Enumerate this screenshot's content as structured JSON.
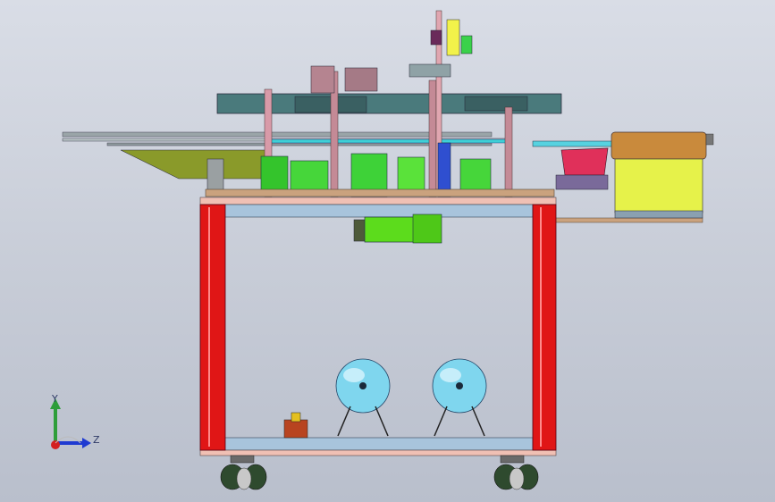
{
  "window": {
    "title": ""
  },
  "triad": {
    "y_label": "Y",
    "z_label": "Z",
    "colors": {
      "y": "#2e9e3a",
      "z": "#1f3bd1",
      "x": "#d42020"
    }
  },
  "model": {
    "frame_color": "#e01616",
    "tank_color": "#7fd6ee",
    "motor_color": "#5cdc1c",
    "bowl_top_color": "#c98a3c",
    "bowl_body_color": "#e6f24a"
  }
}
